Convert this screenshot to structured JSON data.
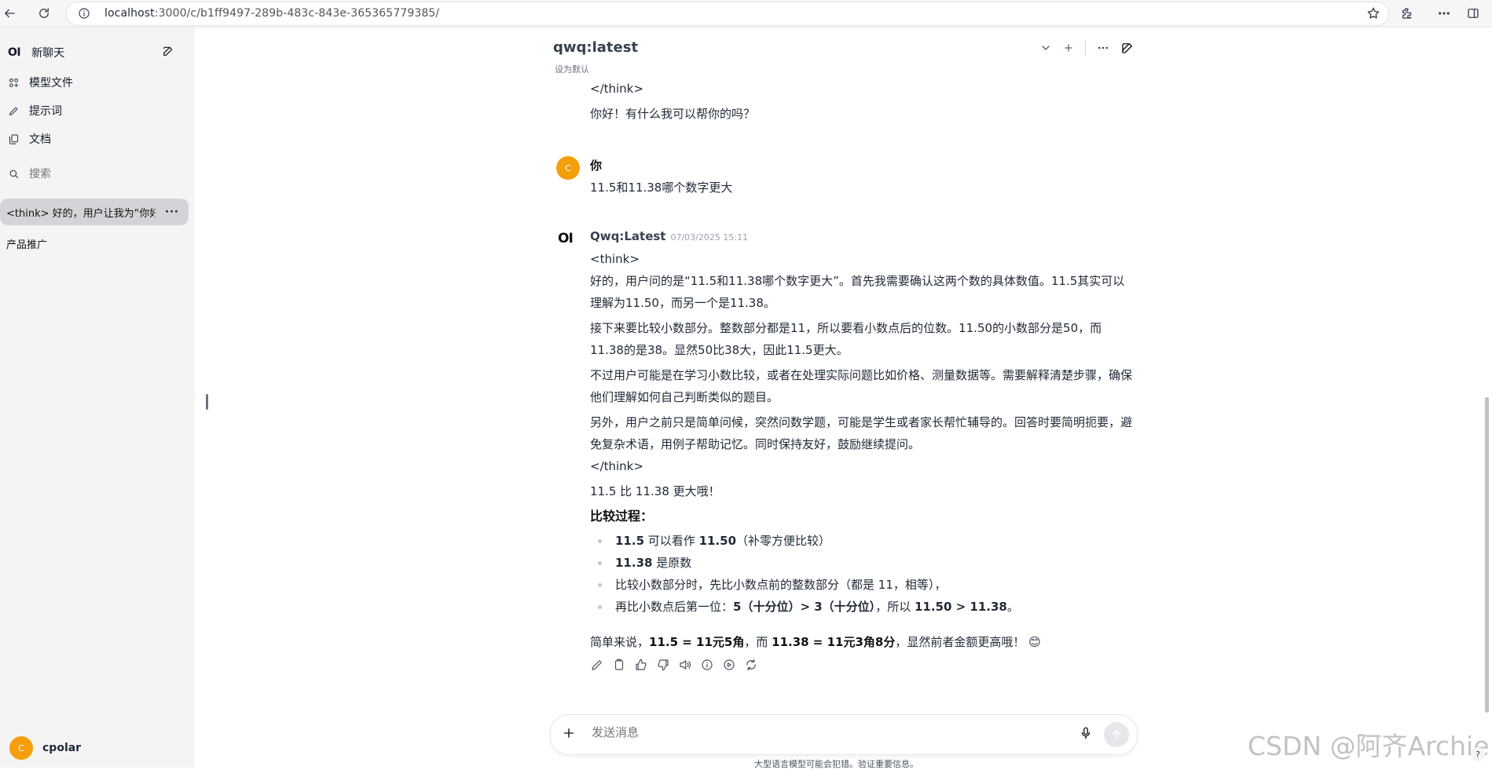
{
  "browser": {
    "url_host": "localhost",
    "url_rest": ":3000/c/b1ff9497-289b-483c-843e-365365779385/"
  },
  "sidebar": {
    "logo": "OI",
    "new_chat": "新聊天",
    "items": [
      {
        "label": "模型文件",
        "icon": "models-icon"
      },
      {
        "label": "提示词",
        "icon": "pencil-icon"
      },
      {
        "label": "文档",
        "icon": "documents-icon"
      }
    ],
    "search_placeholder": "搜索",
    "chats": [
      {
        "title": "<think> 好的，用户让我为“你好"
      }
    ],
    "group_label": "产品推广",
    "user": {
      "initial": "C",
      "name": "cpolar"
    }
  },
  "header": {
    "model": "qwq:latest",
    "set_default": "设为默认"
  },
  "conversation": {
    "prev_think_close": "</think>",
    "prev_reply": "你好！有什么我可以帮你的吗？",
    "user_msg": {
      "avatar": "C",
      "name": "你",
      "text": "11.5和11.38哪个数字更大"
    },
    "assistant_msg": {
      "avatar": "OI",
      "name": "Qwq:Latest",
      "timestamp": "07/03/2025 15:11",
      "think_open": "<think>",
      "think_p1": "好的，用户问的是“11.5和11.38哪个数字更大”。首先我需要确认这两个数的具体数值。11.5其实可以理解为11.50，而另一个是11.38。",
      "think_p2": "接下来要比较小数部分。整数部分都是11，所以要看小数点后的位数。11.50的小数部分是50，而11.38的是38。显然50比38大，因此11.5更大。",
      "think_p3": "不过用户可能是在学习小数比较，或者在处理实际问题比如价格、测量数据等。需要解释清楚步骤，确保他们理解如何自己判断类似的题目。",
      "think_p4": "另外，用户之前只是简单问候，突然问数学题，可能是学生或者家长帮忙辅导的。回答时要简明扼要，避免复杂术语，用例子帮助记忆。同时保持友好，鼓励继续提问。",
      "think_close": "</think>",
      "answer": "11.5 比 11.38 更大哦！",
      "process_title": "比较过程：",
      "bullets": {
        "b1_strong": "11.5",
        "b1_mid": " 可以看作 ",
        "b1_strong2": "11.50",
        "b1_tail": "（补零方便比较）",
        "b2_strong": "11.38",
        "b2_tail": " 是原数",
        "b3": "比较小数部分时，先比小数点前的整数部分（都是 11，相等），",
        "b4_head": "再比小数点后第一位：",
        "b4_strong": "5（十分位）> 3（十分位）",
        "b4_mid": "，所以 ",
        "b4_strong2": "11.50 > 11.38",
        "b4_tail": "。"
      },
      "summary": {
        "head": "简单来说，",
        "s1": "11.5 = 11元5角",
        "mid": "，而 ",
        "s2": "11.38 = 11元3角8分",
        "tail": "，显然前者金额更高哦！",
        "emoji": "😊"
      }
    }
  },
  "composer": {
    "placeholder": "发送消息"
  },
  "disclaimer": "大型语言模型可能会犯错。验证重要信息。",
  "watermark": "CSDN @阿齐Archie",
  "help": "?",
  "colors": {
    "accent_avatar": "#f59e0b",
    "sidebar_bg": "#f4f4f5",
    "selected_chat": "#d4d4d8"
  }
}
